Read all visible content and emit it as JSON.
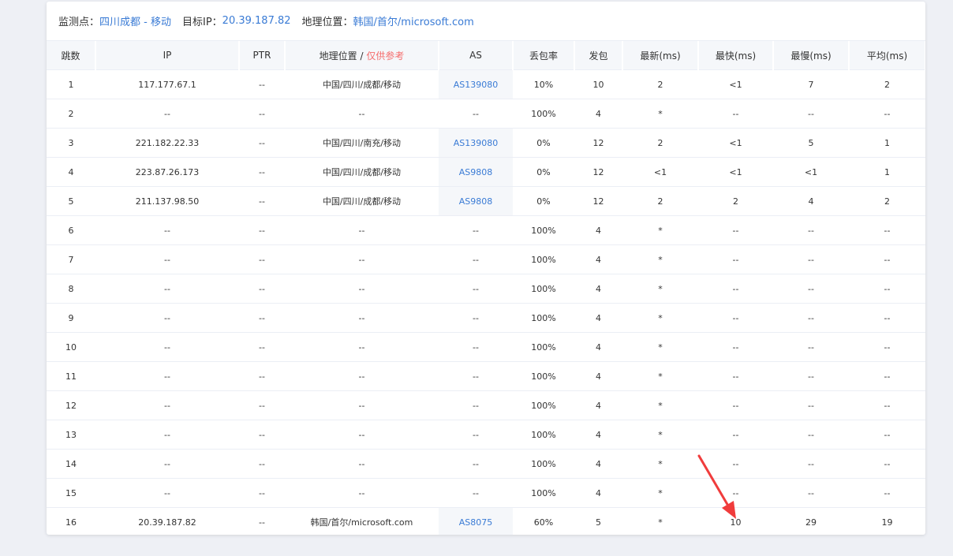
{
  "header": {
    "monitor_label": "监测点：",
    "monitor_value": "四川成都 - 移动",
    "target_label": "目标IP：",
    "target_value": "20.39.187.82",
    "geo_label": "地理位置：",
    "geo_value": "韩国/首尔/microsoft.com"
  },
  "table": {
    "columns": {
      "hop": "跳数",
      "ip": "IP",
      "ptr": "PTR",
      "geo": "地理位置 / ",
      "geo_note": "仅供参考",
      "as": "AS",
      "loss": "丢包率",
      "sent": "发包",
      "last": "最新(ms)",
      "best": "最快(ms)",
      "worst": "最慢(ms)",
      "avg": "平均(ms)"
    },
    "rows": [
      {
        "hop": "1",
        "ip": "117.177.67.1",
        "ptr": "--",
        "geo": "中国/四川/成都/移动",
        "as": "AS139080",
        "loss": "10%",
        "sent": "10",
        "last": "2",
        "best": "<1",
        "worst": "7",
        "avg": "2"
      },
      {
        "hop": "2",
        "ip": "--",
        "ptr": "--",
        "geo": "--",
        "as": "--",
        "loss": "100%",
        "sent": "4",
        "last": "*",
        "best": "--",
        "worst": "--",
        "avg": "--"
      },
      {
        "hop": "3",
        "ip": "221.182.22.33",
        "ptr": "--",
        "geo": "中国/四川/南充/移动",
        "as": "AS139080",
        "loss": "0%",
        "sent": "12",
        "last": "2",
        "best": "<1",
        "worst": "5",
        "avg": "1"
      },
      {
        "hop": "4",
        "ip": "223.87.26.173",
        "ptr": "--",
        "geo": "中国/四川/成都/移动",
        "as": "AS9808",
        "loss": "0%",
        "sent": "12",
        "last": "<1",
        "best": "<1",
        "worst": "<1",
        "avg": "1"
      },
      {
        "hop": "5",
        "ip": "211.137.98.50",
        "ptr": "--",
        "geo": "中国/四川/成都/移动",
        "as": "AS9808",
        "loss": "0%",
        "sent": "12",
        "last": "2",
        "best": "2",
        "worst": "4",
        "avg": "2"
      },
      {
        "hop": "6",
        "ip": "--",
        "ptr": "--",
        "geo": "--",
        "as": "--",
        "loss": "100%",
        "sent": "4",
        "last": "*",
        "best": "--",
        "worst": "--",
        "avg": "--"
      },
      {
        "hop": "7",
        "ip": "--",
        "ptr": "--",
        "geo": "--",
        "as": "--",
        "loss": "100%",
        "sent": "4",
        "last": "*",
        "best": "--",
        "worst": "--",
        "avg": "--"
      },
      {
        "hop": "8",
        "ip": "--",
        "ptr": "--",
        "geo": "--",
        "as": "--",
        "loss": "100%",
        "sent": "4",
        "last": "*",
        "best": "--",
        "worst": "--",
        "avg": "--"
      },
      {
        "hop": "9",
        "ip": "--",
        "ptr": "--",
        "geo": "--",
        "as": "--",
        "loss": "100%",
        "sent": "4",
        "last": "*",
        "best": "--",
        "worst": "--",
        "avg": "--"
      },
      {
        "hop": "10",
        "ip": "--",
        "ptr": "--",
        "geo": "--",
        "as": "--",
        "loss": "100%",
        "sent": "4",
        "last": "*",
        "best": "--",
        "worst": "--",
        "avg": "--"
      },
      {
        "hop": "11",
        "ip": "--",
        "ptr": "--",
        "geo": "--",
        "as": "--",
        "loss": "100%",
        "sent": "4",
        "last": "*",
        "best": "--",
        "worst": "--",
        "avg": "--"
      },
      {
        "hop": "12",
        "ip": "--",
        "ptr": "--",
        "geo": "--",
        "as": "--",
        "loss": "100%",
        "sent": "4",
        "last": "*",
        "best": "--",
        "worst": "--",
        "avg": "--"
      },
      {
        "hop": "13",
        "ip": "--",
        "ptr": "--",
        "geo": "--",
        "as": "--",
        "loss": "100%",
        "sent": "4",
        "last": "*",
        "best": "--",
        "worst": "--",
        "avg": "--"
      },
      {
        "hop": "14",
        "ip": "--",
        "ptr": "--",
        "geo": "--",
        "as": "--",
        "loss": "100%",
        "sent": "4",
        "last": "*",
        "best": "--",
        "worst": "--",
        "avg": "--"
      },
      {
        "hop": "15",
        "ip": "--",
        "ptr": "--",
        "geo": "--",
        "as": "--",
        "loss": "100%",
        "sent": "4",
        "last": "*",
        "best": "--",
        "worst": "--",
        "avg": "--"
      },
      {
        "hop": "16",
        "ip": "20.39.187.82",
        "ptr": "--",
        "geo": "韩国/首尔/microsoft.com",
        "as": "AS8075",
        "loss": "60%",
        "sent": "5",
        "last": "*",
        "best": "10",
        "worst": "29",
        "avg": "19"
      }
    ]
  },
  "annotation": {
    "icon": "red-arrow-icon",
    "color": "#f03c3c"
  }
}
